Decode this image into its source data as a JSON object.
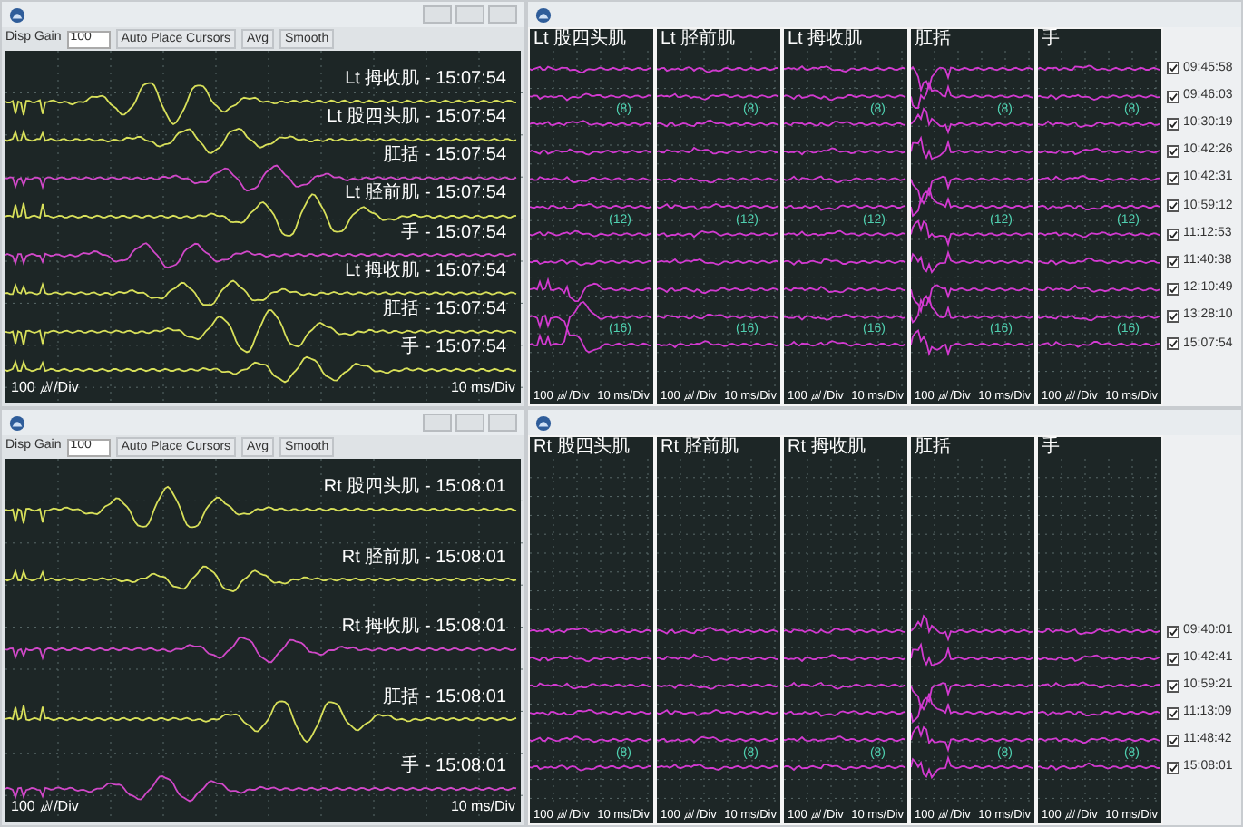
{
  "windows": [
    {
      "kind": "overlay",
      "toolbar": {
        "gain_label": "Disp Gain",
        "gain_value": "100",
        "buttons": [
          "Auto Place Cursors",
          "Avg",
          "Smooth"
        ]
      },
      "traces": [
        {
          "label": "Lt 拇收肌 - 15:07:54",
          "color": "#d8e05a"
        },
        {
          "label": "Lt 股四头肌 - 15:07:54",
          "color": "#d8e05a"
        },
        {
          "label": "肛括 - 15:07:54",
          "color": "#d048c8"
        },
        {
          "label": "Lt 胫前肌 - 15:07:54",
          "color": "#d8e05a"
        },
        {
          "label": "手 - 15:07:54",
          "color": "#d048c8"
        },
        {
          "label": "Lt 拇收肌 - 15:07:54",
          "color": "#d8e05a"
        },
        {
          "label": "肛括 - 15:07:54",
          "color": "#d8e05a"
        },
        {
          "label": "手 - 15:07:54",
          "color": "#d8e05a"
        }
      ],
      "scale_y": "100 ㎶/Div",
      "scale_x": "10 ms/Div"
    },
    {
      "kind": "stack",
      "panels": [
        {
          "title": "Lt 股四头肌",
          "counts": [
            "(8)",
            "(12)",
            "(16)"
          ],
          "scale_y": "100 ㎶/Div",
          "scale_x": "10 ms/Div"
        },
        {
          "title": "Lt 胫前肌",
          "counts": [
            "(8)",
            "(12)",
            "(16)"
          ],
          "scale_y": "100 ㎶/Div",
          "scale_x": "10 ms/Div"
        },
        {
          "title": "Lt 拇收肌",
          "counts": [
            "(8)",
            "(12)",
            "(16)"
          ],
          "scale_y": "100 ㎶/Div",
          "scale_x": "10 ms/Div"
        },
        {
          "title": "肛括",
          "counts": [
            "(8)",
            "(12)",
            "(16)"
          ],
          "scale_y": "100 ㎶/Div",
          "scale_x": "10 ms/Div"
        },
        {
          "title": "手",
          "counts": [
            "(8)",
            "(12)",
            "(16)"
          ],
          "scale_y": "100 ㎶/Div",
          "scale_x": "10 ms/Div"
        }
      ],
      "times": [
        {
          "label": "09:45:58",
          "checked": true
        },
        {
          "label": "09:46:03",
          "checked": true
        },
        {
          "label": "10:30:19",
          "checked": true
        },
        {
          "label": "10:42:26",
          "checked": true
        },
        {
          "label": "10:42:31",
          "checked": true
        },
        {
          "label": "10:59:12",
          "checked": true
        },
        {
          "label": "11:12:53",
          "checked": true
        },
        {
          "label": "11:40:38",
          "checked": true
        },
        {
          "label": "12:10:49",
          "checked": true
        },
        {
          "label": "13:28:10",
          "checked": true
        },
        {
          "label": "15:07:54",
          "checked": true
        }
      ]
    },
    {
      "kind": "overlay",
      "toolbar": {
        "gain_label": "Disp Gain",
        "gain_value": "100",
        "buttons": [
          "Auto Place Cursors",
          "Avg",
          "Smooth"
        ]
      },
      "traces": [
        {
          "label": "Rt 股四头肌 - 15:08:01",
          "color": "#d8e05a"
        },
        {
          "label": "Rt 胫前肌 - 15:08:01",
          "color": "#d8e05a"
        },
        {
          "label": "Rt 拇收肌 - 15:08:01",
          "color": "#d048c8"
        },
        {
          "label": "肛括 - 15:08:01",
          "color": "#d8e05a"
        },
        {
          "label": "手 - 15:08:01",
          "color": "#d048c8"
        }
      ],
      "scale_y": "100 ㎶/Div",
      "scale_x": "10 ms/Div"
    },
    {
      "kind": "stack",
      "panels": [
        {
          "title": "Rt 股四头肌",
          "counts": [
            "(8)"
          ],
          "scale_y": "100 ㎶/Div",
          "scale_x": "10 ms/Div"
        },
        {
          "title": "Rt 胫前肌",
          "counts": [
            "(8)"
          ],
          "scale_y": "100 ㎶/Div",
          "scale_x": "10 ms/Div"
        },
        {
          "title": "Rt 拇收肌",
          "counts": [
            "(8)"
          ],
          "scale_y": "100 ㎶/Div",
          "scale_x": "10 ms/Div"
        },
        {
          "title": "肛括",
          "counts": [
            "(8)"
          ],
          "scale_y": "100 ㎶/Div",
          "scale_x": "10 ms/Div"
        },
        {
          "title": "手",
          "counts": [
            "(8)"
          ],
          "scale_y": "100 ㎶/Div",
          "scale_x": "10 ms/Div"
        }
      ],
      "times": [
        {
          "label": "09:40:01",
          "checked": true
        },
        {
          "label": "10:42:41",
          "checked": true
        },
        {
          "label": "10:59:21",
          "checked": true
        },
        {
          "label": "11:13:09",
          "checked": true
        },
        {
          "label": "11:48:42",
          "checked": true
        },
        {
          "label": "15:08:01",
          "checked": true
        }
      ]
    }
  ]
}
